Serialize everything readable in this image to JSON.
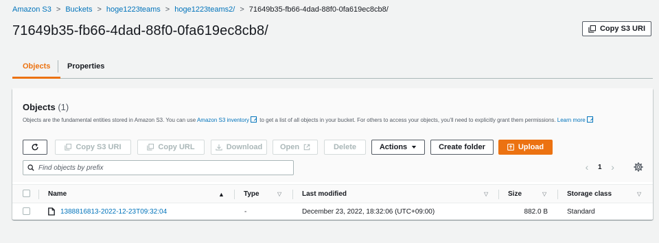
{
  "breadcrumb": {
    "items": [
      "Amazon S3",
      "Buckets",
      "hoge1223teams",
      "hoge1223teams2/"
    ],
    "current": "71649b35-fb66-4dad-88f0-0fa619ec8cb8/"
  },
  "page_title": "71649b35-fb66-4dad-88f0-0fa619ec8cb8/",
  "copy_s3_uri_top": "Copy S3 URI",
  "tabs": [
    {
      "label": "Objects",
      "active": true
    },
    {
      "label": "Properties",
      "active": false
    }
  ],
  "objects": {
    "title": "Objects",
    "count": "(1)",
    "description_before": "Objects are the fundamental entities stored in Amazon S3. You can use ",
    "inventory_link": "Amazon S3 inventory",
    "description_after": " to get a list of all objects in your bucket. For others to access your objects, you’ll need to explicitly grant them permissions. ",
    "learn_more": "Learn more"
  },
  "toolbar": {
    "copy_s3_uri": "Copy S3 URI",
    "copy_url": "Copy URL",
    "download": "Download",
    "open": "Open",
    "delete": "Delete",
    "actions": "Actions",
    "create_folder": "Create folder",
    "upload": "Upload"
  },
  "search": {
    "placeholder": "Find objects by prefix"
  },
  "pagination": {
    "page": "1"
  },
  "table": {
    "columns": {
      "name": "Name",
      "type": "Type",
      "last_modified": "Last modified",
      "size": "Size",
      "storage_class": "Storage class"
    },
    "rows": [
      {
        "name": "1388816813-2022-12-23T09:32:04",
        "type": "-",
        "last_modified": "December 23, 2022, 18:32:06 (UTC+09:00)",
        "size": "882.0 B",
        "storage_class": "Standard"
      }
    ]
  },
  "colors": {
    "link": "#0073bb",
    "accent": "#ec7211",
    "text": "#16191f",
    "muted": "#545b64",
    "background": "#f2f3f3"
  },
  "icons": [
    "refresh-icon",
    "copy-icon",
    "download-icon",
    "external-link-icon",
    "caret-down-icon",
    "upload-icon",
    "search-icon",
    "chevron-left-icon",
    "chevron-right-icon",
    "gear-icon",
    "file-icon",
    "sort-icon"
  ]
}
